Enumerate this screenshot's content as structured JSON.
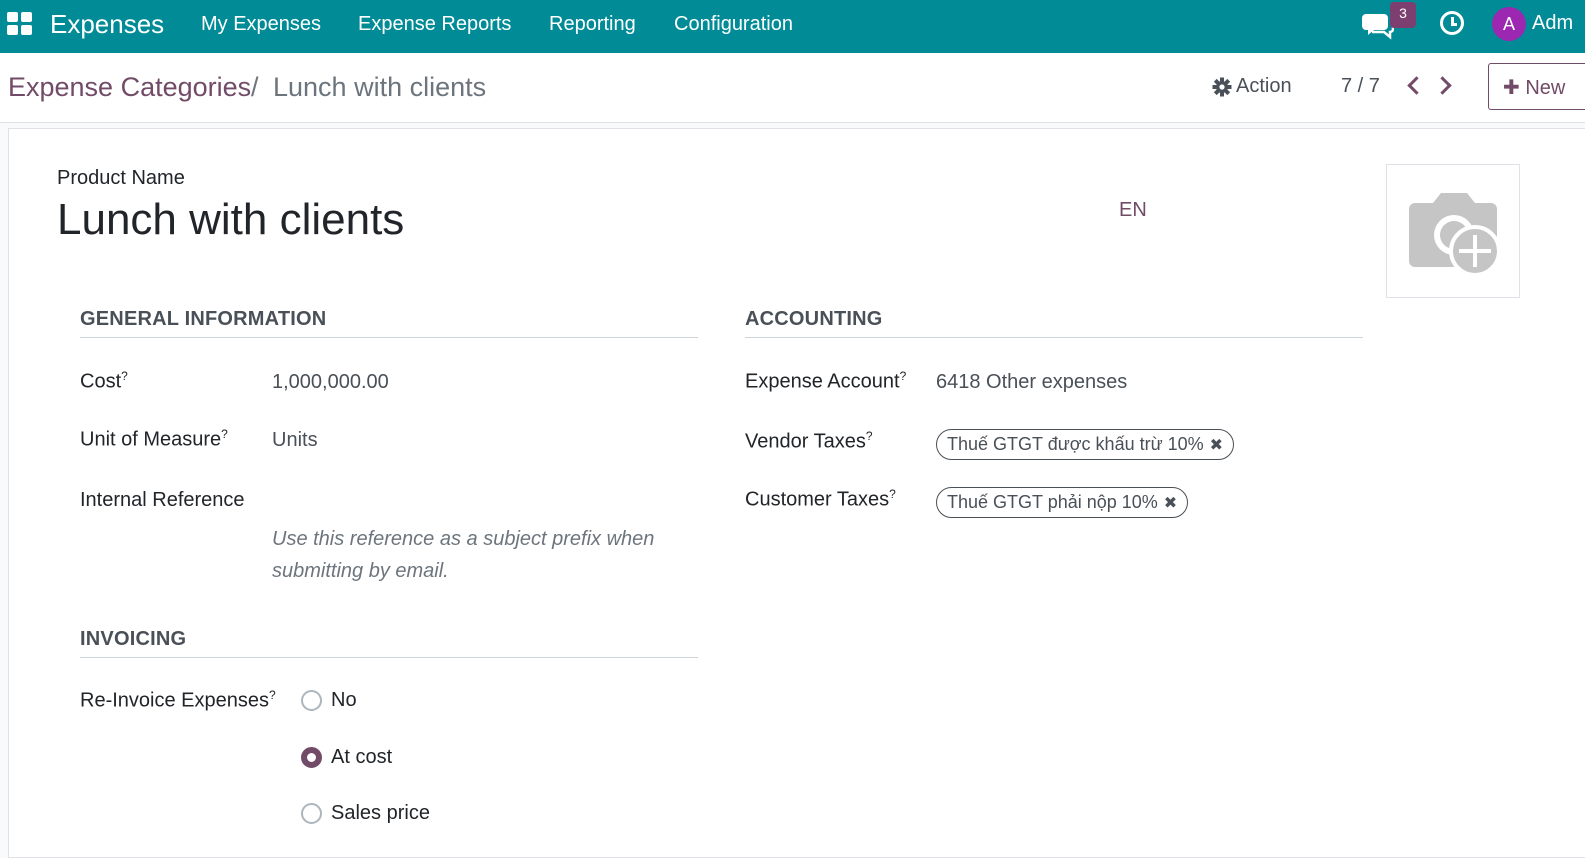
{
  "navbar": {
    "app_name": "Expenses",
    "menu": [
      "My Expenses",
      "Expense Reports",
      "Reporting",
      "Configuration"
    ],
    "chat_badge": "3",
    "avatar_initial": "A",
    "user_name": "Adm"
  },
  "breadcrumb": {
    "parent": "Expense Categories",
    "separator": "/",
    "current": "Lunch with clients"
  },
  "control": {
    "action_label": "Action",
    "pager": "7 / 7",
    "new_label": "New"
  },
  "form": {
    "product_name_label": "Product Name",
    "product_name": "Lunch with clients",
    "lang": "EN",
    "general_title": "GENERAL INFORMATION",
    "accounting_title": "ACCOUNTING",
    "invoicing_title": "INVOICING",
    "cost_label": "Cost",
    "cost_value": "1,000,000.00",
    "uom_label": "Unit of Measure",
    "uom_value": "Units",
    "internal_ref_label": "Internal Reference",
    "internal_ref_placeholder": "Use this reference as a subject prefix when submitting by email.",
    "expense_account_label": "Expense Account",
    "expense_account_value": "6418 Other expenses",
    "vendor_taxes_label": "Vendor Taxes",
    "vendor_tax_tag": "Thuế GTGT được khấu trừ 10%",
    "customer_taxes_label": "Customer Taxes",
    "customer_tax_tag": "Thuế GTGT phải nộp 10%",
    "reinvoice_label": "Re-Invoice Expenses",
    "reinvoice_options": [
      "No",
      "At cost",
      "Sales price"
    ],
    "reinvoice_selected": "At cost",
    "help_marker": "?"
  },
  "colors": {
    "navbar": "#018b96",
    "brand": "#714b67",
    "badge": "#7c3f6f",
    "avatar": "#9c27b0"
  }
}
